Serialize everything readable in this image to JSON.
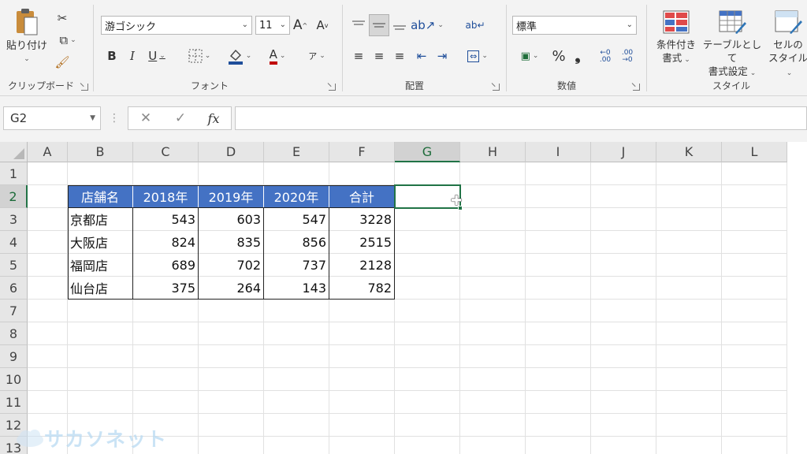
{
  "ribbon": {
    "clipboard": {
      "paste_label": "貼り付け",
      "group_label": "クリップボード"
    },
    "font": {
      "font_name": "游ゴシック",
      "font_size": "11",
      "group_label": "フォント",
      "bold": "B",
      "italic": "I",
      "underline": "U",
      "grow": "A",
      "shrink": "A",
      "color_a": "A",
      "phonetic": "ア"
    },
    "alignment": {
      "group_label": "配置"
    },
    "number": {
      "format": "標準",
      "group_label": "数値",
      "percent": "%",
      "comma": "❟",
      "inc_dec": "←0 .00",
      "dec_dec": ".00 →0"
    },
    "styles": {
      "group_label": "スタイル",
      "conditional_l1": "条件付き",
      "conditional_l2": "書式",
      "table_l1": "テーブルとして",
      "table_l2": "書式設定",
      "cell_l1": "セルの",
      "cell_l2": "スタイル"
    }
  },
  "formula_bar": {
    "name_box": "G2",
    "cancel": "✕",
    "enter": "✓",
    "fx": "fx",
    "value": ""
  },
  "grid": {
    "columns": [
      "A",
      "B",
      "C",
      "D",
      "E",
      "F",
      "G",
      "H",
      "I",
      "J",
      "K",
      "L"
    ],
    "rows": [
      "1",
      "2",
      "3",
      "4",
      "5",
      "6",
      "7",
      "8",
      "9",
      "10",
      "11",
      "12",
      "13"
    ],
    "selected_cell": "G2",
    "table_header": [
      "店舗名",
      "2018年",
      "2019年",
      "2020年",
      "合計"
    ],
    "table_rows": [
      [
        "京都店",
        "543",
        "603",
        "547",
        "3228"
      ],
      [
        "大阪店",
        "824",
        "835",
        "856",
        "2515"
      ],
      [
        "福岡店",
        "689",
        "702",
        "737",
        "2128"
      ],
      [
        "仙台店",
        "375",
        "264",
        "143",
        "782"
      ]
    ]
  },
  "watermark": {
    "text": "サカソネット"
  },
  "colors": {
    "header_fill": "#4472c4",
    "accent": "#217346"
  }
}
